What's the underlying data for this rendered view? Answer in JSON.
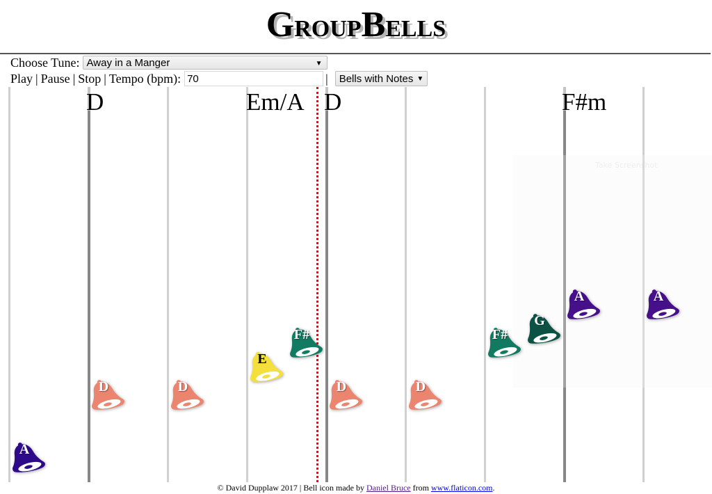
{
  "header": {
    "title_first_cap": "G",
    "title_rest1": "roup",
    "title_second_cap": "B",
    "title_rest2": "ells"
  },
  "controls": {
    "choose_tune_label": "Choose Tune:",
    "tune_selected": "Away in a Manger",
    "play_label": "Play",
    "pause_label": "Pause",
    "stop_label": "Stop",
    "separator": "|",
    "tempo_label": "Tempo (bpm):",
    "tempo_value": "70",
    "display_mode_selected": "Bells with Notes",
    "dropdown_arrow": "▼"
  },
  "score": {
    "chords": [
      {
        "label": "D",
        "beat": 1
      },
      {
        "label": "Em/A",
        "beat": 3
      },
      {
        "label": "D",
        "beat": 4
      },
      {
        "label": "F#m",
        "beat": 7
      }
    ],
    "bar_lines_at_beats": [
      1,
      4,
      7
    ],
    "playhead_beat": 3.9,
    "notes": [
      {
        "note": "A",
        "pitch": "A3",
        "beat": 0,
        "color": "#2e0a8a"
      },
      {
        "note": "D",
        "pitch": "D4",
        "beat": 1,
        "color": "#ec8570"
      },
      {
        "note": "D",
        "pitch": "D4",
        "beat": 2,
        "color": "#ec8570"
      },
      {
        "note": "E",
        "pitch": "E4",
        "beat": 3,
        "color": "#f4e03c",
        "dark_text": true
      },
      {
        "note": "F#",
        "pitch": "F#4",
        "beat": 3.5,
        "color": "#137a62"
      },
      {
        "note": "D",
        "pitch": "D4",
        "beat": 4,
        "color": "#ec8570"
      },
      {
        "note": "D",
        "pitch": "D4",
        "beat": 5,
        "color": "#ec8570"
      },
      {
        "note": "F#",
        "pitch": "F#4",
        "beat": 6,
        "color": "#137a62"
      },
      {
        "note": "G",
        "pitch": "G4",
        "beat": 6.5,
        "color": "#0b5244"
      },
      {
        "note": "A",
        "pitch": "A4",
        "beat": 7,
        "color": "#45108a"
      },
      {
        "note": "A",
        "pitch": "A4",
        "beat": 8,
        "color": "#45108a"
      }
    ]
  },
  "overlay": {
    "text": "Take Screenshot"
  },
  "footer": {
    "copyright": "© David Dupplaw 2017 | Bell icon made by ",
    "author_link": "Daniel Bruce",
    "from_text": " from ",
    "site_link": "www.flaticon.com",
    "end": "."
  }
}
